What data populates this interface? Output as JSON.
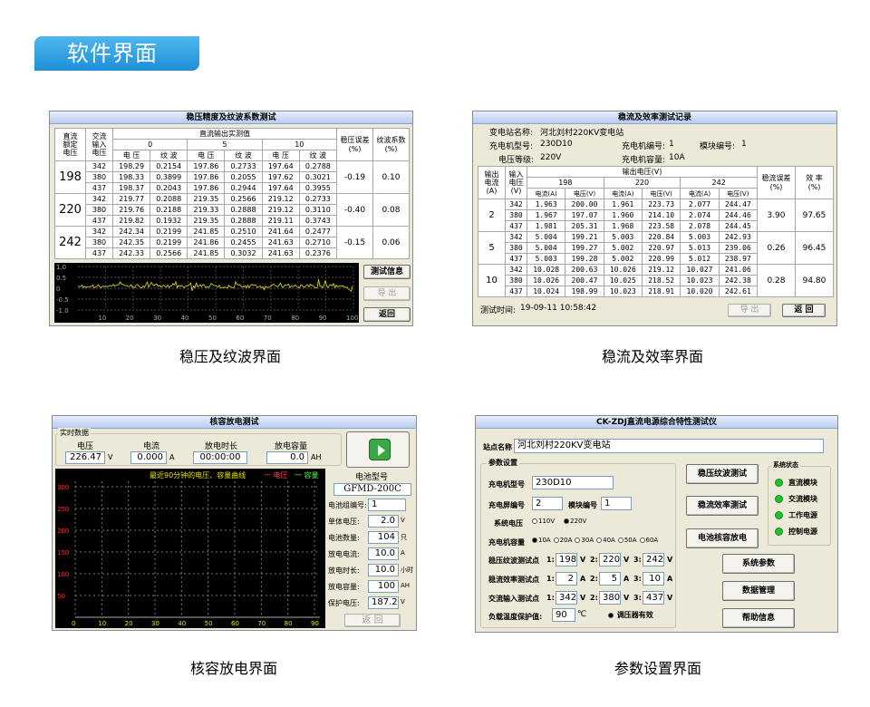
{
  "header": {
    "title": "软件界面"
  },
  "captions": [
    "稳压及纹波界面",
    "稳流及效率界面",
    "核容放电界面",
    "参数设置界面"
  ],
  "p1": {
    "title": "稳压精度及纹波系数测试",
    "h_dc_set": "直流\n额定\n电压",
    "h_ac_in": "交流\n输入\n电压",
    "h_out": "直流输出实测值",
    "h_err": "稳压误差\n(%)",
    "h_ripple": "纹波系数\n(%)",
    "currents": [
      "0",
      "5",
      "10"
    ],
    "sub_v": "电 压",
    "sub_r": "纹 波",
    "groups": [
      {
        "set": "198",
        "err": "-0.19",
        "rip": "0.10",
        "rows": [
          [
            "342",
            "198.29",
            "0.2154",
            "197.86",
            "0.2733",
            "197.64",
            "0.2788"
          ],
          [
            "380",
            "198.33",
            "0.3899",
            "197.86",
            "0.2055",
            "197.62",
            "0.3021"
          ],
          [
            "437",
            "198.37",
            "0.2043",
            "197.86",
            "0.2944",
            "197.64",
            "0.3955"
          ]
        ]
      },
      {
        "set": "220",
        "err": "-0.40",
        "rip": "0.08",
        "rows": [
          [
            "342",
            "219.77",
            "0.2088",
            "219.35",
            "0.2566",
            "219.12",
            "0.2733"
          ],
          [
            "380",
            "219.76",
            "0.2188",
            "219.33",
            "0.2888",
            "219.12",
            "0.3110"
          ],
          [
            "437",
            "219.82",
            "0.1932",
            "219.35",
            "0.2888",
            "219.11",
            "0.3743"
          ]
        ]
      },
      {
        "set": "242",
        "err": "-0.15",
        "rip": "0.06",
        "rows": [
          [
            "342",
            "242.34",
            "0.2199",
            "241.85",
            "0.2510",
            "241.64",
            "0.2477"
          ],
          [
            "380",
            "242.35",
            "0.2199",
            "241.86",
            "0.2455",
            "241.63",
            "0.2710"
          ],
          [
            "437",
            "242.33",
            "0.2566",
            "241.85",
            "0.3032",
            "241.63",
            "0.2376"
          ]
        ]
      }
    ],
    "yticks": [
      "1.0",
      "0.5",
      "0",
      "-0.5",
      "-1.0"
    ],
    "xticks": [
      "10",
      "20",
      "30",
      "40",
      "50",
      "60",
      "70",
      "80",
      "90",
      "100"
    ],
    "btn_info": "测试信息",
    "btn_export": "导 出",
    "btn_back": "返回"
  },
  "p2": {
    "title": "稳流及效率测试记录",
    "station_label": "变电站名称:",
    "station": "河北刘村220KV变电站",
    "model_label": "充电机型号:",
    "model": "230D10",
    "chg_no_label": "充电机编号:",
    "chg_no": "1",
    "mod_no_label": "模块编号:",
    "mod_no": "1",
    "grade_label": "电压等级:",
    "grade": "220V",
    "cap_label": "充电机容量:",
    "cap": "10A",
    "h_out_i": "输出\n电流\n(A)",
    "h_in_v": "输入\n电压\n(V)",
    "h_out_v": "输出电压(V)",
    "h_err": "稳流误差\n(%)",
    "h_eff": "效 率\n(%)",
    "volts": [
      "198",
      "220",
      "242"
    ],
    "sub_i": "电流(A)",
    "sub_v": "电压(V)",
    "groups": [
      {
        "i": "2",
        "err": "3.90",
        "eff": "97.65",
        "rows": [
          [
            "342",
            "1.963",
            "200.00",
            "1.961",
            "223.73",
            "2.077",
            "244.47"
          ],
          [
            "380",
            "1.967",
            "197.07",
            "1.960",
            "214.10",
            "2.074",
            "244.46"
          ],
          [
            "437",
            "1.981",
            "205.31",
            "1.968",
            "223.58",
            "2.078",
            "244.45"
          ]
        ]
      },
      {
        "i": "5",
        "err": "0.26",
        "eff": "96.45",
        "rows": [
          [
            "342",
            "5.004",
            "199.21",
            "5.003",
            "220.84",
            "5.003",
            "242.93"
          ],
          [
            "380",
            "5.004",
            "199.27",
            "5.002",
            "220.97",
            "5.013",
            "239.06"
          ],
          [
            "437",
            "5.003",
            "199.28",
            "5.002",
            "220.99",
            "5.012",
            "238.97"
          ]
        ]
      },
      {
        "i": "10",
        "err": "0.28",
        "eff": "94.80",
        "rows": [
          [
            "342",
            "10.028",
            "200.63",
            "10.026",
            "219.12",
            "10.027",
            "241.06"
          ],
          [
            "380",
            "10.026",
            "200.47",
            "10.025",
            "218.52",
            "10.023",
            "242.38"
          ],
          [
            "437",
            "10.024",
            "198.99",
            "10.023",
            "218.91",
            "10.020",
            "242.61"
          ]
        ]
      }
    ],
    "time_label": "测试时间:",
    "time": "19-09-11  10:58:42",
    "btn_export": "导 出",
    "btn_back": "返 回"
  },
  "p3": {
    "title": "核容放电测试",
    "realtime": "实时数据",
    "volt_label": "电压",
    "volt": "226.47",
    "volt_unit": "V",
    "cur_label": "电流",
    "cur": "0.000",
    "cur_unit": "A",
    "dur_label": "放电时长",
    "dur": "00:00:00",
    "capa_label": "放电容量",
    "capa": "0.0",
    "capa_unit": "AH",
    "chart_title": "最近90分钟的电压、容量曲线",
    "legend_v": "一 电压",
    "legend_c": "一 容量",
    "yticks": [
      "300",
      "250",
      "200",
      "150",
      "100",
      "50"
    ],
    "xticks": [
      "0",
      "10",
      "20",
      "30",
      "40",
      "50",
      "60",
      "70",
      "80",
      "90"
    ],
    "bat_model_label": "电池型号",
    "bat_model": "GFMD-200C",
    "fields": [
      {
        "label": "电池组编号:",
        "value": "1",
        "unit": ""
      },
      {
        "label": "单体电压:",
        "value": "2.0",
        "unit": "V"
      },
      {
        "label": "电池数量:",
        "value": "104",
        "unit": "只"
      },
      {
        "label": "放电电流:",
        "value": "10.0",
        "unit": "A"
      },
      {
        "label": "放电时长:",
        "value": "10.0",
        "unit": "小时"
      },
      {
        "label": "放电容量:",
        "value": "100",
        "unit": "AH"
      },
      {
        "label": "保护电压:",
        "value": "187.2",
        "unit": "V"
      }
    ],
    "btn_back": "返 回"
  },
  "p4": {
    "title": "CK-ZDJ直流电源综合特性测试仪",
    "station_label": "站点名称",
    "station": "河北刘村220KV变电站",
    "param_group": "参数设置",
    "model_label": "充电机型号",
    "model": "230D10",
    "chg_no_label": "充电屏编号",
    "chg_no": "2",
    "mod_no_label": "模块编号",
    "mod_no": "1",
    "sysv_label": "系统电压",
    "sysv_opts": [
      "110V",
      "220V"
    ],
    "sysv_sel": 1,
    "cap_label": "充电机容量",
    "cap_opts": [
      "10A",
      "20A",
      "30A",
      "40A",
      "50A",
      "60A"
    ],
    "cap_sel": 0,
    "rows": [
      {
        "label": "稳压纹波测试点",
        "v1": "198",
        "v2": "220",
        "v3": "242",
        "unit": "V"
      },
      {
        "label": "稳流效率测试点",
        "v1": "2",
        "v2": "5",
        "v3": "10",
        "unit": "A"
      },
      {
        "label": "交流输入测试点",
        "v1": "342",
        "v2": "380",
        "v3": "437",
        "unit": "V"
      }
    ],
    "idx": [
      "1:",
      "2:",
      "3:"
    ],
    "temp_label": "负载温度保护值:",
    "temp": "90",
    "temp_unit": "℃",
    "reg_label": "调压器有效",
    "btn_ripple": "稳压纹波测试",
    "btn_eff": "稳流效率测试",
    "btn_bat": "电池核容放电",
    "btn_sys": "系统参数",
    "btn_data": "数据管理",
    "btn_help": "帮助信息",
    "status_group": "系统状态",
    "status": [
      "直流模块",
      "交流模块",
      "工作电源",
      "控制电源"
    ],
    "status_color": "#22c22e"
  }
}
